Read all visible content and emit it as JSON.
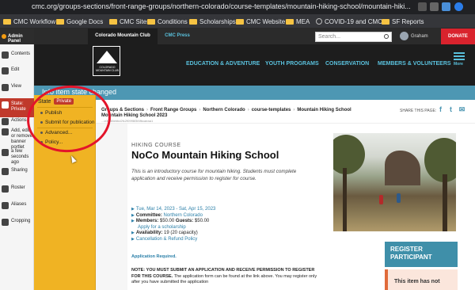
{
  "browser": {
    "url": "cmc.org/groups-sections/front-range-groups/northern-colorado/course-templates/mountain-hiking-school/mountain-hiki..."
  },
  "bookmarks": [
    "CMC Workflow",
    "Google Docs",
    "CMC Sites",
    "Conditions",
    "Scholarships",
    "CMC Website",
    "MEA",
    "COVID-19 and CMC...",
    "SF Reports"
  ],
  "admin_toolbar": {
    "admin_panel": "Admin Panel",
    "items": [
      "Contents",
      "Edit",
      "View",
      "State: Private",
      "Actions",
      "Add, edit or remove banner portlet",
      "a few seconds ago",
      "Sharing",
      "Roster",
      "Aliases",
      "Cropping"
    ]
  },
  "state_menu": {
    "label": "State",
    "badge": "Private",
    "options": [
      "Publish",
      "Submit for publication",
      "Advanced...",
      "Policy..."
    ]
  },
  "site": {
    "top_tabs": [
      "Colorado Mountain Club",
      "CMC Press"
    ],
    "search_placeholder": "Search...",
    "user_name": "Graham",
    "donate": "DONATE",
    "logo_text": "COLORADO MOUNTAIN CLUB",
    "nav": [
      "EDUCATION & ADVENTURE",
      "YOUTH PROGRAMS",
      "CONSERVATION",
      "MEMBERS & VOLUNTEERS"
    ],
    "more": "More"
  },
  "status_message": "Info Item state changed",
  "breadcrumbs": {
    "parts": [
      "Groups & Sections",
      "Front Range Groups",
      "Northern Colorado",
      "course-templates",
      "Mountain Hiking School"
    ],
    "line2": "Mountain Hiking School 2023",
    "line3": "...c00-38ebbd2fc2f0996f3f4fbcaeaa1",
    "share_label": "SHARE THIS PAGE:"
  },
  "course": {
    "kicker": "HIKING COURSE",
    "title": "NoCo Mountain Hiking School",
    "intro": "This is an introductory course for mountain hiking. Students must complete application and receive permission to register for course.",
    "dates": "Tue, Mar 14, 2023 - Sat, Apr 15, 2023",
    "committee_label": "Committee:",
    "committee": "Northern Colorado",
    "members_label": "Members:",
    "members_price": "$50.00",
    "guests_label": "Guests:",
    "guests_price": "$50.00",
    "scholarship": "Apply for a scholarship",
    "availability_label": "Availability:",
    "availability": "19 (20 capacity)",
    "policy": "Cancellation & Refund Policy",
    "app_required": "Application Required.",
    "note_bold": "NOTE:  YOU MUST SUBMIT AN APPLICATION AND RECEIVE PERMISSION TO REGISTER FOR THIS COURSE.",
    "note_text": "The application form can be found at the link above.  You may register only after you have submitted the application"
  },
  "register": {
    "title": "REGISTER PARTICIPANT",
    "not_open": "This item has not"
  }
}
